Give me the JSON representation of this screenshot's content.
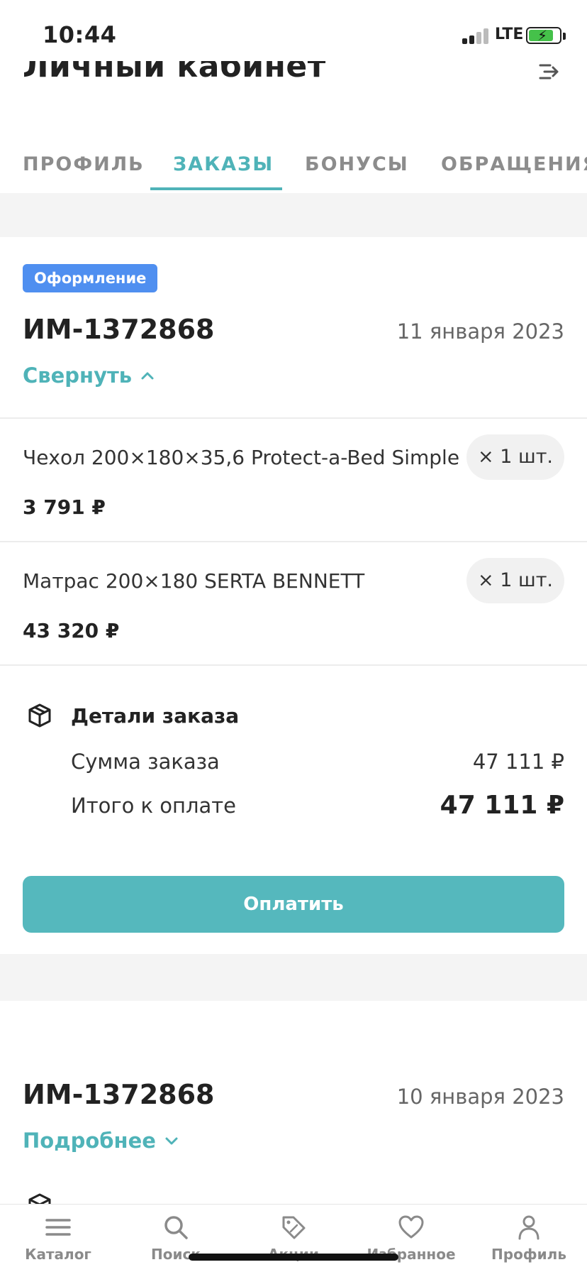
{
  "status_bar": {
    "time": "10:44",
    "network": "LTE"
  },
  "header": {
    "title": "Личный кабинет"
  },
  "tabs": [
    {
      "label": "ПРОФИЛЬ"
    },
    {
      "label": "ЗАКАЗЫ",
      "active": true
    },
    {
      "label": "БОНУСЫ"
    },
    {
      "label": "ОБРАЩЕНИЯ"
    }
  ],
  "orders": [
    {
      "status": "Оформление",
      "number": "ИМ-1372868",
      "date": "11 января 2023",
      "toggle_label": "Свернуть",
      "items": [
        {
          "name": "Чехол 200×180×35,6 Protect-a-Bed Simple",
          "qty": "× 1 шт.",
          "price": "3 791 ₽"
        },
        {
          "name": "Матрас 200×180 SERTA BENNETT",
          "qty": "× 1 шт.",
          "price": "43 320 ₽"
        }
      ],
      "details": {
        "title": "Детали заказа",
        "sum_label": "Сумма заказа",
        "sum_value": "47 111 ₽",
        "total_label": "Итого к оплате",
        "total_value": "47 111 ₽"
      },
      "pay_button": "Оплатить"
    },
    {
      "number": "ИМ-1372868",
      "date": "10 января 2023",
      "toggle_label": "Подробнее"
    }
  ],
  "bottom_nav": [
    {
      "label": "Каталог",
      "icon": "menu-icon"
    },
    {
      "label": "Поиск",
      "icon": "search-icon"
    },
    {
      "label": "Акции",
      "icon": "tag-icon"
    },
    {
      "label": "Избранное",
      "icon": "heart-icon"
    },
    {
      "label": "Профиль",
      "icon": "user-icon"
    }
  ],
  "colors": {
    "accent": "#4fb3b8",
    "badge": "#4f8ff0",
    "button": "#55b8bd"
  }
}
